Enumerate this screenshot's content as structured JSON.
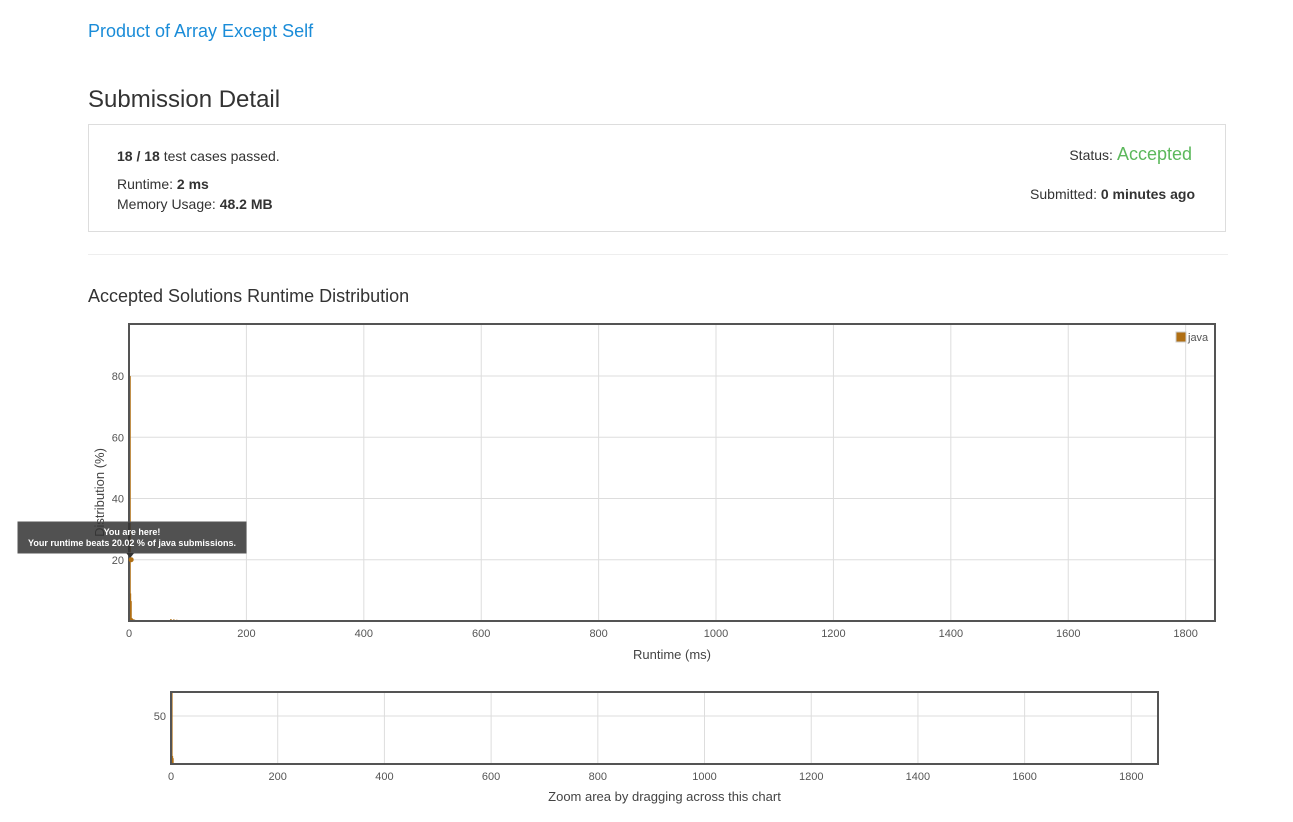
{
  "problem": {
    "title": "Product of Array Except Self"
  },
  "page": {
    "title": "Submission Detail"
  },
  "detail": {
    "passed": "18",
    "separator": " / ",
    "total": "18",
    "cases_suffix": " test cases passed.",
    "runtime_label": "Runtime: ",
    "runtime_value": "2 ms",
    "memory_label": "Memory Usage: ",
    "memory_value": "48.2 MB",
    "status_label": "Status:",
    "status_value": "Accepted",
    "submitted_label": "Submitted: ",
    "submitted_value": "0 minutes ago"
  },
  "distribution": {
    "title": "Accepted Solutions Runtime Distribution"
  },
  "colors": {
    "bar": "#b06f14",
    "accepted": "#5cb85c",
    "link": "#1a8cd8"
  },
  "chart_data": [
    {
      "type": "bar",
      "xlabel": "Runtime (ms)",
      "ylabel": "Distribution (%)",
      "xlim": [
        0,
        1850
      ],
      "ylim": [
        0,
        97
      ],
      "xticks": [
        "0",
        "200",
        "400",
        "600",
        "800",
        "1000",
        "1200",
        "1400",
        "1600",
        "1800"
      ],
      "yticks": [
        "20",
        "40",
        "60",
        "80"
      ],
      "legend": [
        "java"
      ],
      "legend_position": "top-right",
      "grid": true,
      "series": [
        {
          "name": "java",
          "x": [
            0,
            1,
            2,
            3,
            4,
            5,
            6,
            7,
            8,
            9,
            10,
            12,
            15,
            20,
            25,
            30,
            40,
            50,
            60,
            70,
            75,
            80,
            90,
            100,
            110,
            120,
            130,
            140,
            150,
            160,
            170,
            180,
            190,
            200,
            210,
            220,
            230,
            240,
            250,
            260,
            270,
            280,
            290,
            310,
            330,
            340,
            350,
            360,
            370,
            380,
            400,
            420,
            450,
            480,
            500,
            520,
            550,
            580,
            640,
            730,
            740,
            750,
            760,
            920,
            930,
            940,
            950,
            960,
            970,
            1080,
            1100,
            1110,
            1120,
            1200,
            1240,
            1270,
            1280,
            1290,
            1300,
            1310,
            1320,
            1330,
            1340,
            1350,
            1360,
            1470,
            1480,
            1680,
            1780,
            1840
          ],
          "values": [
            80,
            9,
            6.5,
            1,
            0.8,
            0.6,
            0.5,
            0.5,
            0.4,
            0.3,
            0.3,
            0.3,
            0.3,
            0.3,
            0.3,
            0.3,
            0.3,
            0.3,
            0.3,
            0.6,
            0.5,
            0.4,
            0.3,
            0.3,
            0.3,
            0.3,
            0.3,
            0.3,
            0.3,
            0.3,
            0.3,
            0.3,
            0.3,
            0.3,
            0.3,
            0.3,
            0.3,
            0.3,
            0.3,
            0.3,
            0.3,
            0.3,
            0.3,
            0.3,
            0.3,
            0.3,
            0.3,
            0.3,
            0.3,
            0.3,
            0.3,
            0.3,
            0.3,
            0.3,
            0.3,
            0.3,
            0.3,
            0.3,
            0.3,
            0.3,
            0.3,
            0.3,
            0.3,
            0.3,
            0.3,
            0.3,
            0.3,
            0.3,
            0.3,
            0.3,
            0.3,
            0.3,
            0.3,
            0.3,
            0.3,
            0.3,
            0.3,
            0.3,
            0.3,
            0.3,
            0.3,
            0.3,
            0.3,
            0.3,
            0.3,
            0.3,
            0.3,
            0.3,
            0.3,
            0.3
          ]
        }
      ],
      "tooltip": {
        "line1": "You are here!",
        "line2": "Your runtime beats 20.02 % of java submissions.",
        "x": 2,
        "y": 20.02
      }
    },
    {
      "type": "bar",
      "xlabel": "Zoom area by dragging across this chart",
      "xlim": [
        0,
        1850
      ],
      "ylim": [
        0,
        75
      ],
      "xticks": [
        "0",
        "200",
        "400",
        "600",
        "800",
        "1000",
        "1200",
        "1400",
        "1600",
        "1800"
      ],
      "yticks": [
        "50"
      ],
      "grid": true
    }
  ]
}
